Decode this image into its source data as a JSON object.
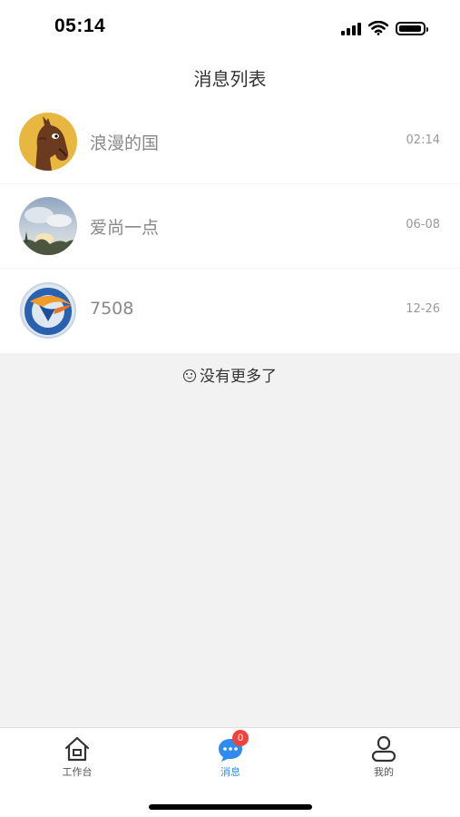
{
  "status_bar": {
    "time": "05:14"
  },
  "nav": {
    "title": "消息列表"
  },
  "messages": [
    {
      "name": "浪漫的国",
      "time": "02:14",
      "avatar": "horse-avatar"
    },
    {
      "name": "爱尚一点",
      "time": "06-08",
      "avatar": "sky-photo-avatar"
    },
    {
      "name": "7508",
      "time": "12-26",
      "avatar": "logo-avatar"
    }
  ],
  "list_end": {
    "text": "没有更多了"
  },
  "tabs": {
    "workbench": {
      "label": "工作台",
      "icon": "home-icon"
    },
    "messages": {
      "label": "消息",
      "icon": "chat-bubble-icon",
      "badge": "0",
      "active": true
    },
    "mine": {
      "label": "我的",
      "icon": "user-icon"
    }
  },
  "colors": {
    "accent": "#2f8bf0",
    "badge": "#f0433a",
    "background": "#f2f2f2"
  }
}
